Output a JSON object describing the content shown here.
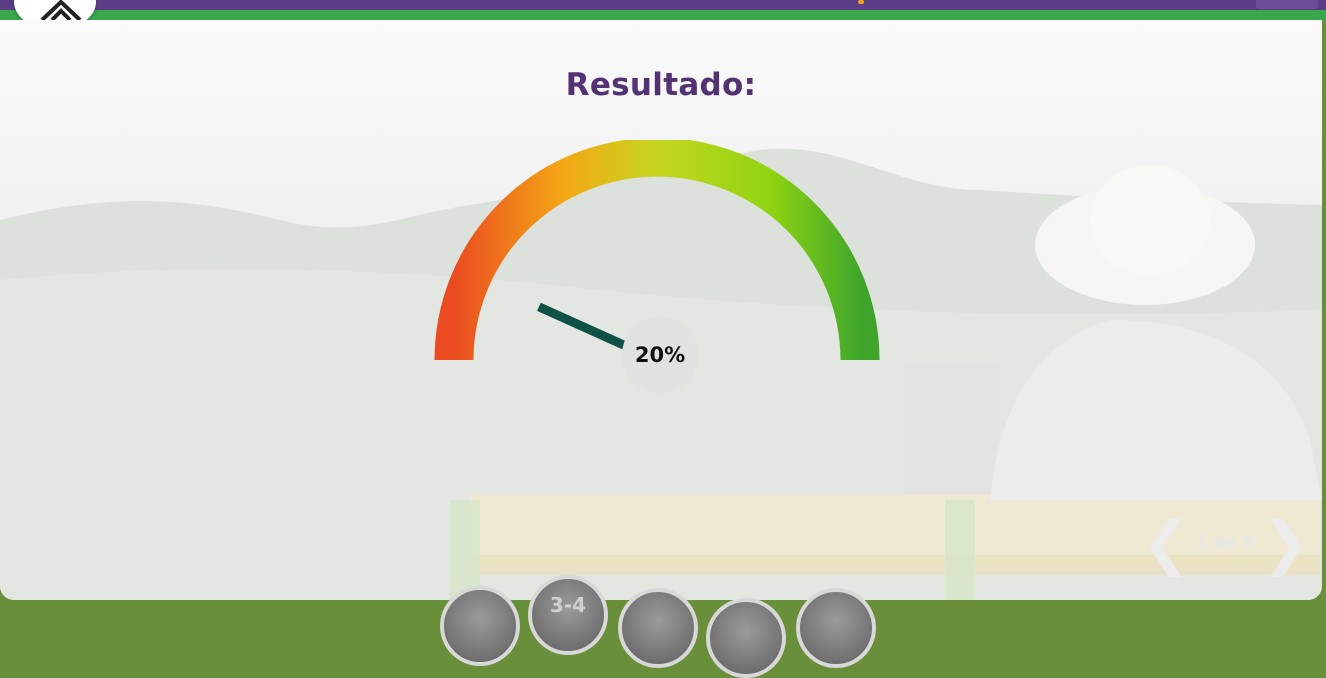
{
  "header": {
    "logo_icon": "up-chevrons-icon",
    "brand_colors": {
      "purple": "#5b3d86",
      "green": "#39a84a"
    }
  },
  "main": {
    "title": "Resultado:",
    "gauge": {
      "value_label": "20%",
      "percent": 20,
      "colors": [
        "#ea4b20",
        "#f4a715",
        "#c6d61f",
        "#8fd412",
        "#3fa52a"
      ],
      "needle_color": "#0e5145"
    }
  },
  "pager": {
    "prev_icon": "chevron-left-icon",
    "next_icon": "chevron-right-icon",
    "label": "1 de 5"
  },
  "bottom_nav": {
    "buttons": [
      {
        "label": ""
      },
      {
        "label": "3-4"
      },
      {
        "label": ""
      },
      {
        "label": ""
      },
      {
        "label": ""
      }
    ]
  }
}
